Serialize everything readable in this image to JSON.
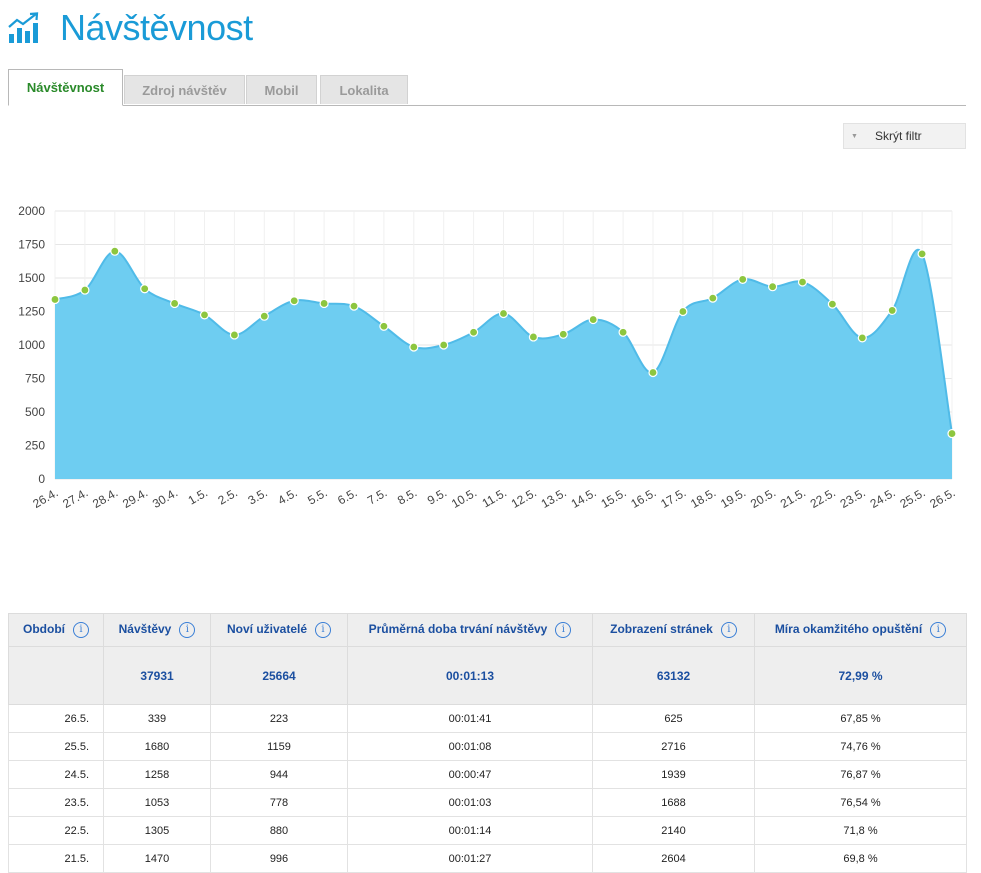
{
  "header": {
    "title": "Návštěvnost",
    "icon": "bar-chart-up-icon"
  },
  "tabs": [
    {
      "label": "Návštěvnost",
      "active": true
    },
    {
      "label": "Zdroj návštěv",
      "active": false
    },
    {
      "label": "Mobil",
      "active": false
    },
    {
      "label": "Lokalita",
      "active": false
    }
  ],
  "filter": {
    "label": "Skrýt filtr"
  },
  "colors": {
    "area": "#6ecdf1",
    "line": "#50bbe8",
    "marker": "#8dc63f",
    "accent": "#1a9bd7"
  },
  "chart_data": {
    "type": "area",
    "x": [
      "26.4.",
      "27.4.",
      "28.4.",
      "29.4.",
      "30.4.",
      "1.5.",
      "2.5.",
      "3.5.",
      "4.5.",
      "5.5.",
      "6.5.",
      "7.5.",
      "8.5.",
      "9.5.",
      "10.5.",
      "11.5.",
      "12.5.",
      "13.5.",
      "14.5.",
      "15.5.",
      "16.5.",
      "17.5.",
      "18.5.",
      "19.5.",
      "20.5.",
      "21.5.",
      "22.5.",
      "23.5.",
      "24.5.",
      "25.5.",
      "26.5."
    ],
    "series": [
      {
        "values": [
          1340,
          1410,
          1700,
          1420,
          1310,
          1225,
          1075,
          1215,
          1330,
          1310,
          1290,
          1140,
          985,
          1000,
          1095,
          1235,
          1060,
          1080,
          1190,
          1095,
          795,
          1250,
          1350,
          1490,
          1435,
          1470,
          1305,
          1053,
          1258,
          1680,
          339
        ]
      }
    ],
    "ylim": [
      0,
      2000
    ],
    "yticks": [
      0,
      250,
      500,
      750,
      1000,
      1250,
      1500,
      1750,
      2000
    ],
    "grid": true
  },
  "table": {
    "headers": [
      "Období",
      "Návštěvy",
      "Noví uživatelé",
      "Průměrná doba trvání návštěvy",
      "Zobrazení stránek",
      "Míra okamžitého opuštění"
    ],
    "totals": [
      "",
      "37931",
      "25664",
      "00:01:13",
      "63132",
      "72,99 %"
    ],
    "rows": [
      [
        "26.5.",
        "339",
        "223",
        "00:01:41",
        "625",
        "67,85 %"
      ],
      [
        "25.5.",
        "1680",
        "1159",
        "00:01:08",
        "2716",
        "74,76 %"
      ],
      [
        "24.5.",
        "1258",
        "944",
        "00:00:47",
        "1939",
        "76,87 %"
      ],
      [
        "23.5.",
        "1053",
        "778",
        "00:01:03",
        "1688",
        "76,54 %"
      ],
      [
        "22.5.",
        "1305",
        "880",
        "00:01:14",
        "2140",
        "71,8 %"
      ],
      [
        "21.5.",
        "1470",
        "996",
        "00:01:27",
        "2604",
        "69,8 %"
      ]
    ]
  }
}
